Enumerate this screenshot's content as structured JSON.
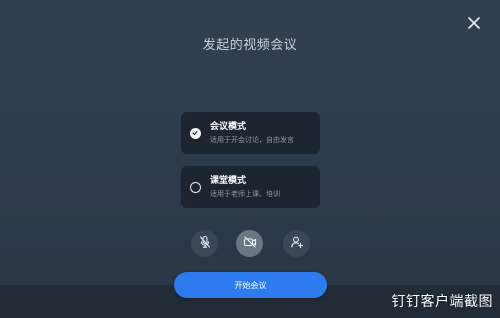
{
  "dialog": {
    "title": "发起的视频会议"
  },
  "modes": [
    {
      "name": "会议模式",
      "description": "适用于开会讨论，自由发言",
      "selected": true
    },
    {
      "name": "课堂模式",
      "description": "适用于老师上课、培训",
      "selected": false
    }
  ],
  "controls": {
    "mic_icon": "mic-muted-icon",
    "camera_icon": "camera-off-icon",
    "invite_icon": "add-user-icon"
  },
  "start_button": {
    "label": "开始会议"
  },
  "watermark": {
    "text": "钉钉客户端截图"
  },
  "colors": {
    "background": "#2e3b4a",
    "card": "#1c2530",
    "accent": "#2e7bf0"
  }
}
